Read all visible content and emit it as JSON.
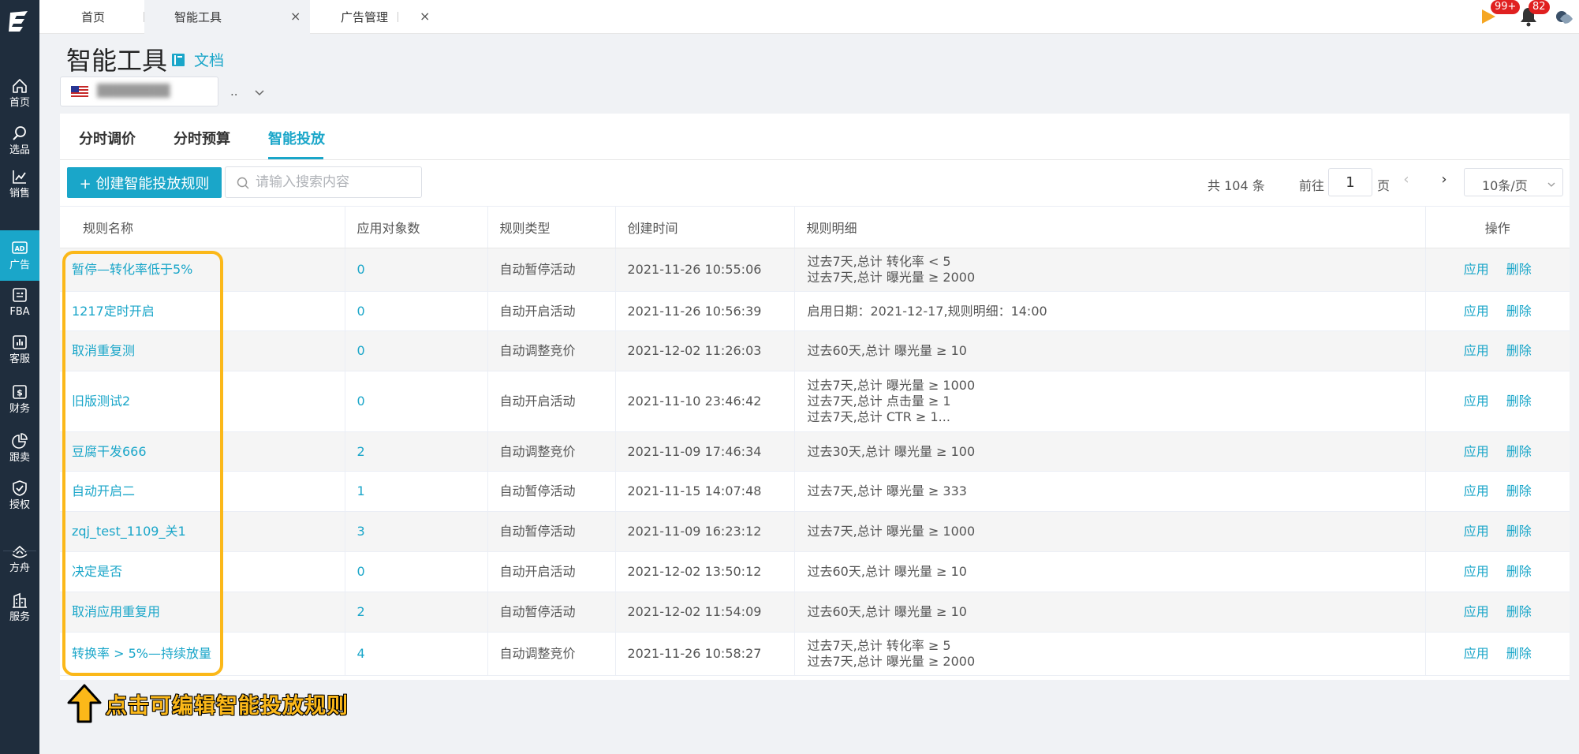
{
  "top_tabs": [
    {
      "label": "首页"
    },
    {
      "label": "智能工具",
      "close": "×"
    },
    {
      "label": "广告管理",
      "close": "×"
    }
  ],
  "badges": {
    "video": "99+",
    "bell": "82"
  },
  "sidebar": {
    "items": [
      {
        "label": "首页",
        "icon": "home-icon"
      },
      {
        "label": "选品",
        "icon": "search-icon"
      },
      {
        "label": "销售",
        "icon": "chart-line-icon"
      },
      {
        "label": "广告",
        "icon": "ad-icon",
        "active": true
      },
      {
        "label": "FBA",
        "icon": "fba-icon"
      },
      {
        "label": "客服",
        "icon": "bar-chart-icon"
      },
      {
        "label": "财务",
        "icon": "dollar-icon"
      },
      {
        "label": "跟卖",
        "icon": "pie-chart-icon"
      },
      {
        "label": "授权",
        "icon": "shield-check-icon"
      },
      {
        "label": "方舟",
        "icon": "ark-icon"
      },
      {
        "label": "服务",
        "icon": "building-icon"
      }
    ]
  },
  "page": {
    "title": "智能工具",
    "doc_label": "文档",
    "account_ellipsis": ".."
  },
  "sub_tabs": [
    {
      "label": "分时调价"
    },
    {
      "label": "分时预算"
    },
    {
      "label": "智能投放",
      "active": true
    }
  ],
  "toolbar": {
    "create_label": "+ 创建智能投放规则",
    "search_placeholder": "请输入搜索内容"
  },
  "pagination": {
    "total": "共 104 条",
    "goto_label": "前往",
    "page_value": "1",
    "page_unit": "页",
    "prev": "‹",
    "next": "›",
    "page_size": "10条/页"
  },
  "table": {
    "headers": [
      "规则名称",
      "应用对象数",
      "规则类型",
      "创建时间",
      "规则明细",
      "操作"
    ],
    "action_apply": "应用",
    "action_delete": "删除",
    "rows": [
      {
        "name": "暂停—转化率低于5%",
        "count": "0",
        "type": "自动暂停活动",
        "created": "2021-11-26 10:55:06",
        "details": [
          "过去7天,总计  转化率 < 5",
          "过去7天,总计  曝光量 ≥ 2000"
        ]
      },
      {
        "name": "1217定时开启",
        "count": "0",
        "type": "自动开启活动",
        "created": "2021-11-26 10:56:39",
        "details": [
          "启用日期：2021-12-17,规则明细：14:00"
        ]
      },
      {
        "name": "取消重复测",
        "count": "0",
        "type": "自动调整竞价",
        "created": "2021-12-02 11:26:03",
        "details": [
          "过去60天,总计  曝光量 ≥ 10"
        ]
      },
      {
        "name": "旧版测试2",
        "count": "0",
        "type": "自动开启活动",
        "created": "2021-11-10 23:46:42",
        "details": [
          "过去7天,总计  曝光量 ≥ 1000",
          "过去7天,总计  点击量 ≥ 1",
          "过去7天,总计  CTR ≥ 1..."
        ]
      },
      {
        "name": "豆腐干发666",
        "count": "2",
        "type": "自动调整竞价",
        "created": "2021-11-09 17:46:34",
        "details": [
          "过去30天,总计  曝光量 ≥ 100"
        ]
      },
      {
        "name": "自动开启二",
        "count": "1",
        "type": "自动暂停活动",
        "created": "2021-11-15 14:07:48",
        "details": [
          "过去7天,总计  曝光量 ≥ 333"
        ]
      },
      {
        "name": "zqj_test_1109_关1",
        "count": "3",
        "type": "自动暂停活动",
        "created": "2021-11-09 16:23:12",
        "details": [
          "过去7天,总计  曝光量 ≥ 1000"
        ]
      },
      {
        "name": "决定是否",
        "count": "0",
        "type": "自动开启活动",
        "created": "2021-12-02 13:50:12",
        "details": [
          "过去60天,总计  曝光量 ≥ 10"
        ]
      },
      {
        "name": "取消应用重复用",
        "count": "2",
        "type": "自动暂停活动",
        "created": "2021-12-02 11:54:09",
        "details": [
          "过去60天,总计  曝光量 ≥ 10"
        ]
      },
      {
        "name": "转换率 > 5%—持续放量",
        "count": "4",
        "type": "自动调整竞价",
        "created": "2021-11-26 10:58:27",
        "details": [
          "过去7天,总计  转化率 ≥ 5",
          "过去7天,总计  曝光量 ≥ 2000"
        ]
      }
    ]
  },
  "annotation": {
    "callout": "点击可编辑智能投放规则",
    "highlight_color": "#fbb819"
  },
  "colors": {
    "accent": "#1aa6c9",
    "sidebar_bg": "#1f2d3d",
    "badge": "#e02020"
  }
}
